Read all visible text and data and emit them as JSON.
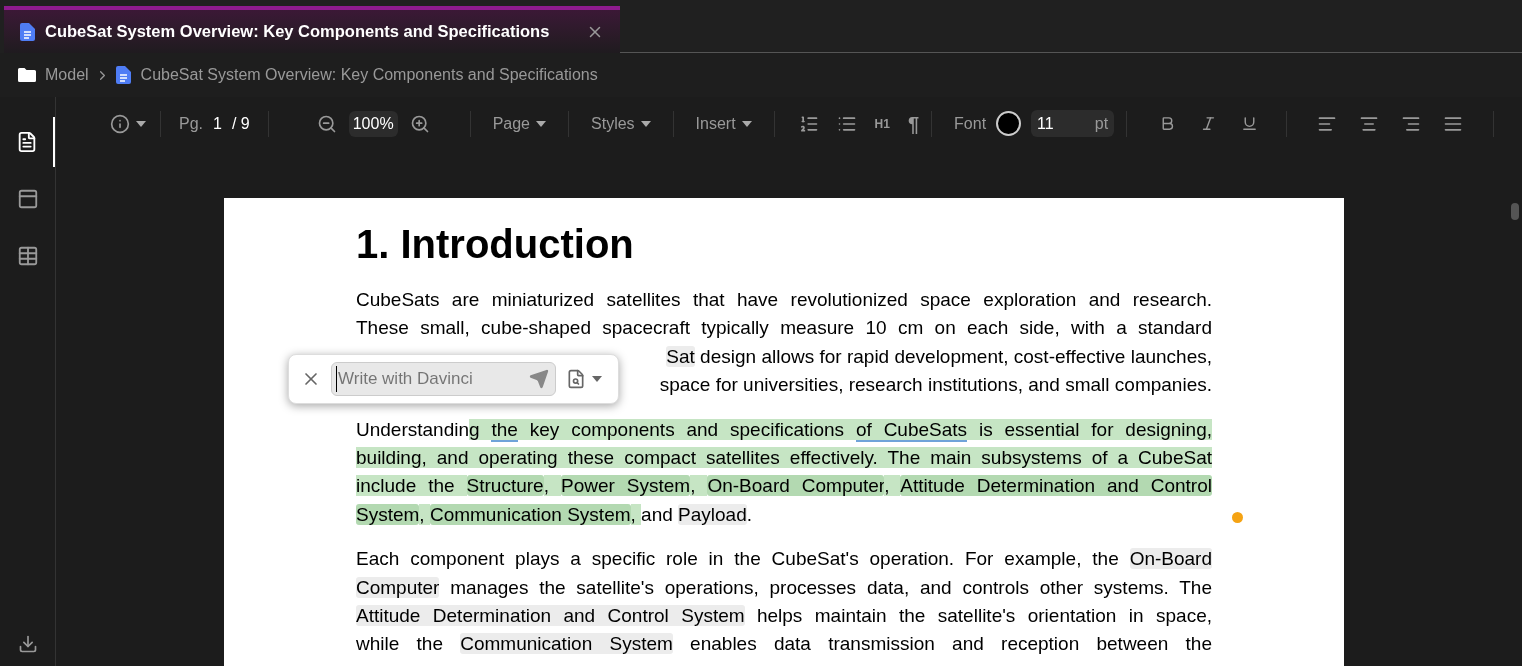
{
  "tab": {
    "title": "CubeSat System Overview: Key Components and Specifications",
    "selected": true
  },
  "breadcrumb": [
    "Model",
    "CubeSat System Overview: Key Components and Specifications"
  ],
  "sidebar": [
    {
      "kind": "document",
      "selected": true
    },
    {
      "kind": "panel",
      "selected": false
    },
    {
      "kind": "table",
      "selected": false
    }
  ],
  "toolbar": {
    "page_label": "Pg.",
    "page": "1",
    "page_total": "/ 9",
    "zoom": "100%",
    "menus": [
      "Page",
      "Styles",
      "Insert"
    ],
    "heading": "H1",
    "paragraph_mark": "¶",
    "font_label": "Font",
    "font_size": "11",
    "font_unit": "pt"
  },
  "document": {
    "heading": "1. Introduction",
    "paragraphs": [
      {
        "lines": [
          {
            "kind": "justified",
            "segments": [
              {
                "kind": "plain",
                "text": "CubeSats are miniaturized satellites that have revolutionized space exploration and research."
              }
            ]
          },
          {
            "kind": "justified",
            "segments": [
              {
                "kind": "plain",
                "text": "These small, cube-shaped spacecraft typically measure 10 cm on each side, with a standard"
              }
            ]
          },
          {
            "kind": "partial",
            "segments": [
              {
                "kind": "term",
                "text": "Sat"
              },
              {
                "kind": "plain",
                "text": " design allows for rapid development, cost-effective launches,"
              }
            ]
          },
          {
            "kind": "partial",
            "segments": [
              {
                "kind": "plain",
                "text": "space for universities, research institutions, and small companies."
              }
            ]
          }
        ]
      },
      {
        "comment_marker": true,
        "lines": [
          {
            "kind": "justified",
            "segments": [
              {
                "kind": "plain",
                "text": "Understandin"
              },
              {
                "kind": "ai",
                "text": "g "
              },
              {
                "kind": "ai_underline",
                "text": "the"
              },
              {
                "kind": "ai",
                "text": " key components and specifications "
              },
              {
                "kind": "ai_underline",
                "text": "of CubeSats"
              },
              {
                "kind": "ai",
                "text": " is essential for designing,"
              }
            ]
          },
          {
            "kind": "justified",
            "segments": [
              {
                "kind": "ai",
                "text": "building, and operating these compact satellites effectively. The main subsystems of a CubeSat"
              }
            ]
          },
          {
            "kind": "justified",
            "segments": [
              {
                "kind": "ai",
                "text": "include the "
              },
              {
                "kind": "ai_term",
                "text": "Structure"
              },
              {
                "kind": "ai",
                "text": ", "
              },
              {
                "kind": "ai_term",
                "text": "Power System"
              },
              {
                "kind": "ai",
                "text": ", "
              },
              {
                "kind": "ai_term",
                "text": "On-Board Computer"
              },
              {
                "kind": "ai",
                "text": ", "
              },
              {
                "kind": "ai_term",
                "text": "Attitude Determination and Control"
              }
            ]
          },
          {
            "kind": "last",
            "segments": [
              {
                "kind": "ai_term",
                "text": "System"
              },
              {
                "kind": "ai",
                "text": ", "
              },
              {
                "kind": "ai_term",
                "text": "Communication System"
              },
              {
                "kind": "ai",
                "text": ", "
              },
              {
                "kind": "plain",
                "text": "and "
              },
              {
                "kind": "term",
                "text": "Payload"
              },
              {
                "kind": "plain",
                "text": "."
              }
            ]
          }
        ]
      },
      {
        "lines": [
          {
            "kind": "justified",
            "segments": [
              {
                "kind": "plain",
                "text": "Each component plays a specific role in the CubeSat's operation. For example, the "
              },
              {
                "kind": "term",
                "text": "On-Board"
              }
            ]
          },
          {
            "kind": "justified",
            "segments": [
              {
                "kind": "term",
                "text": "Computer"
              },
              {
                "kind": "plain",
                "text": " manages the satellite's operations, processes data, and controls other systems. The"
              }
            ]
          },
          {
            "kind": "justified",
            "segments": [
              {
                "kind": "term",
                "text": "Attitude Determination and Control System"
              },
              {
                "kind": "plain",
                "text": " helps maintain the satellite's orientation in space,"
              }
            ]
          },
          {
            "kind": "justified",
            "segments": [
              {
                "kind": "plain",
                "text": "while the "
              },
              {
                "kind": "term",
                "text": "Communication System"
              },
              {
                "kind": "plain",
                "text": " enables data transmission and reception between the"
              }
            ]
          }
        ]
      }
    ]
  },
  "ai_prompt": {
    "placeholder": "Write with Davinci"
  }
}
